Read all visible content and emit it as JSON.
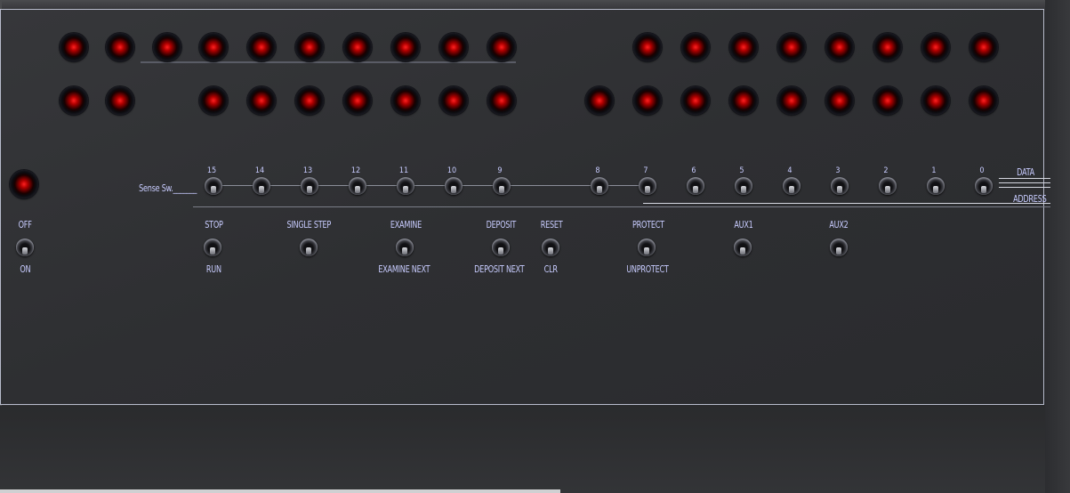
{
  "panel": {
    "labels": {
      "sense_sw": "Sense Sw._______",
      "data": "DATA",
      "address": "ADDRESS",
      "off": "OFF",
      "on": "ON",
      "stop": "STOP",
      "run": "RUN",
      "single_step": "SINGLE STEP",
      "examine": "EXAMINE",
      "examine_next": "EXAMINE NEXT",
      "deposit": "DEPOSIT",
      "deposit_next": "DEPOSIT NEXT",
      "reset": "RESET",
      "clr": "CLR",
      "protect": "PROTECT",
      "unprotect": "UNPROTECT",
      "aux1": "AUX1",
      "aux2": "AUX2"
    },
    "bit_numbers": [
      "15",
      "14",
      "13",
      "12",
      "11",
      "10",
      "9",
      "8",
      "7",
      "6",
      "5",
      "4",
      "3",
      "2",
      "1",
      "0"
    ],
    "colors": {
      "label": "#c8ccff",
      "led_on": "#ff2020",
      "panel": "#2e2f32"
    }
  }
}
